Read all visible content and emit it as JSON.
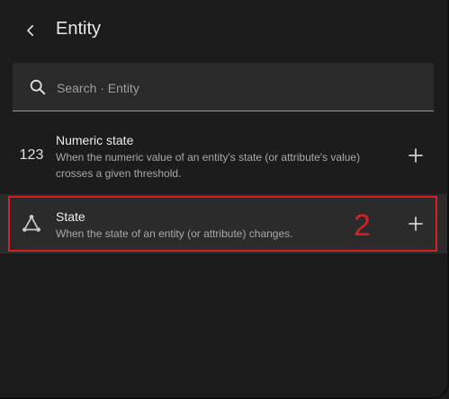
{
  "header": {
    "title": "Entity"
  },
  "search": {
    "placeholder": "Search · Entity",
    "value": ""
  },
  "items": [
    {
      "icon": "numeric-123-icon",
      "icon_text": "123",
      "title": "Numeric state",
      "description": "When the numeric value of an entity's state (or attribute's value) crosses a given threshold."
    },
    {
      "icon": "state-graph-icon",
      "title": "State",
      "description": "When the state of an entity (or attribute) changes."
    }
  ],
  "annotation": {
    "label": "2",
    "color": "#d71f26"
  }
}
